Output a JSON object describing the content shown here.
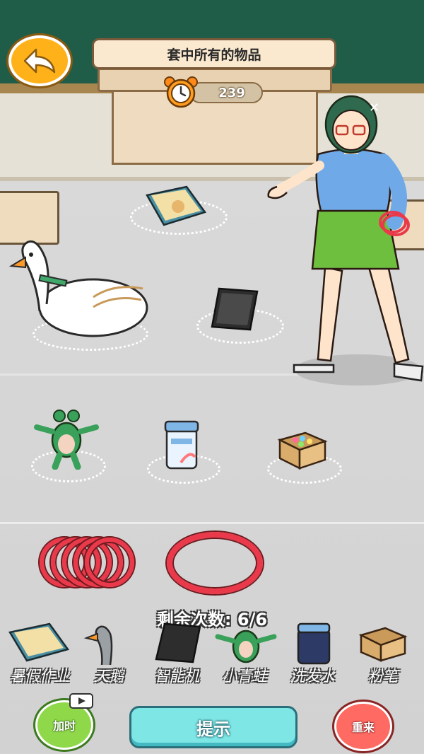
{
  "header": {
    "title": "套中所有的物品",
    "timer_value": "239"
  },
  "status": {
    "remaining_label": "剩余次数:",
    "remaining_value": "6/6"
  },
  "targets": [
    {
      "name": "summer-homework",
      "label": "暑假作业"
    },
    {
      "name": "swan",
      "label": "天鹅"
    },
    {
      "name": "smartphone",
      "label": "智能机"
    },
    {
      "name": "little-frog",
      "label": "小青蛙"
    },
    {
      "name": "shampoo",
      "label": "洗发水"
    },
    {
      "name": "chalk",
      "label": "粉笔"
    }
  ],
  "buttons": {
    "add_time": "加时",
    "hint": "提示",
    "restart": "重来"
  },
  "icons": {
    "back": "back-arrow-icon",
    "timer": "alarm-clock-icon",
    "video": "video-ad-icon"
  },
  "colors": {
    "board": "#1f5d48",
    "back_button": "#ffb11a",
    "ring": "#e9394a",
    "hint_button": "#7fe6e6",
    "add_time_button": "#8fd84a",
    "restart_button": "#ff6a63"
  }
}
